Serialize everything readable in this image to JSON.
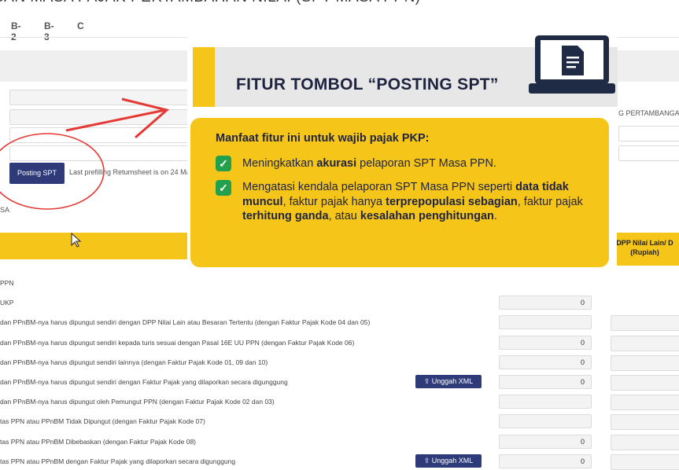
{
  "page": {
    "title": "SAN MASA PAJAK PERTAMBAHAN NILAI (SPT MASA PPN)",
    "tabs": [
      "B-2",
      "B-3",
      "C"
    ]
  },
  "form": {
    "posting_button": "Posting SPT",
    "prefill_note": "Last prefilling Returnsheet is on 24 Ma",
    "section_label": "SA",
    "right_header_text": "G PERTAMBANGAN",
    "right_col_header": "DPP Nilai Lain/ D\n(Rupiah)"
  },
  "rows": [
    {
      "label": "PPN",
      "value": null,
      "upload": null
    },
    {
      "label": "UKP",
      "value": "0",
      "upload": null
    },
    {
      "label": "dan PPnBM-nya harus dipungut sendiri dengan DPP Nilai Lain atau Besaran Tertentu (dengan Faktur Pajak Kode 04 dan 05)",
      "value": "",
      "upload": null
    },
    {
      "label": "dan PPnBM-nya harus dipungut sendiri kepada turis sesuai dengan Pasal 16E UU PPN (dengan Faktur Pajak Kode 06)",
      "value": "0",
      "upload": null
    },
    {
      "label": "dan PPnBM-nya harus dipungut sendiri lainnya (dengan Faktur Pajak Kode 01, 09 dan 10)",
      "value": "0",
      "upload": null
    },
    {
      "label": "dan PPnBM-nya harus dipungut sendiri dengan Faktur Pajak yang dilaporkan secara digunggung",
      "value": "0",
      "upload": "Unggah XML"
    },
    {
      "label": "dan PPnBM-nya harus dipungut oleh Pemungut PPN (dengan Faktur Pajak Kode 02 dan 03)",
      "value": "",
      "upload": null
    },
    {
      "label": "tas PPN atau PPnBM Tidak Dipungut (dengan Faktur Pajak Kode 07)",
      "value": "",
      "upload": null
    },
    {
      "label": "tas PPN atau PPnBM Dibebaskan (dengan Faktur Pajak Kode 08)",
      "value": "0",
      "upload": null
    },
    {
      "label": "tas PPN atau PPnBM dengan Faktur Pajak yang dilaporkan secara digunggung",
      "value": "0",
      "upload": "Unggah XML"
    }
  ],
  "overlay": {
    "title": "FITUR TOMBOL “POSTING SPT”",
    "benefit_heading": "Manfaat fitur ini untuk wajib pajak PKP:",
    "benefits": [
      {
        "pre": "Meningkatkan ",
        "bold": "akurasi",
        "post": " pelaporan SPT Masa PPN."
      },
      {
        "part1": "Mengatasi kendala pelaporan SPT Masa PPN seperti ",
        "b1": "data tidak muncul",
        "part2": ", faktur pajak hanya ",
        "b2": "terprepopulasi sebagian",
        "part3": ", faktur pajak ",
        "b3": "terhitung ganda",
        "part4": ", atau ",
        "b4": "kesalahan penghitungan",
        "part5": "."
      }
    ],
    "icon": "laptop-document-icon"
  },
  "colors": {
    "accent_yellow": "#f6c519",
    "navy": "#2e3b78",
    "check_green": "#22a04b",
    "annotation_red": "#e53935"
  }
}
